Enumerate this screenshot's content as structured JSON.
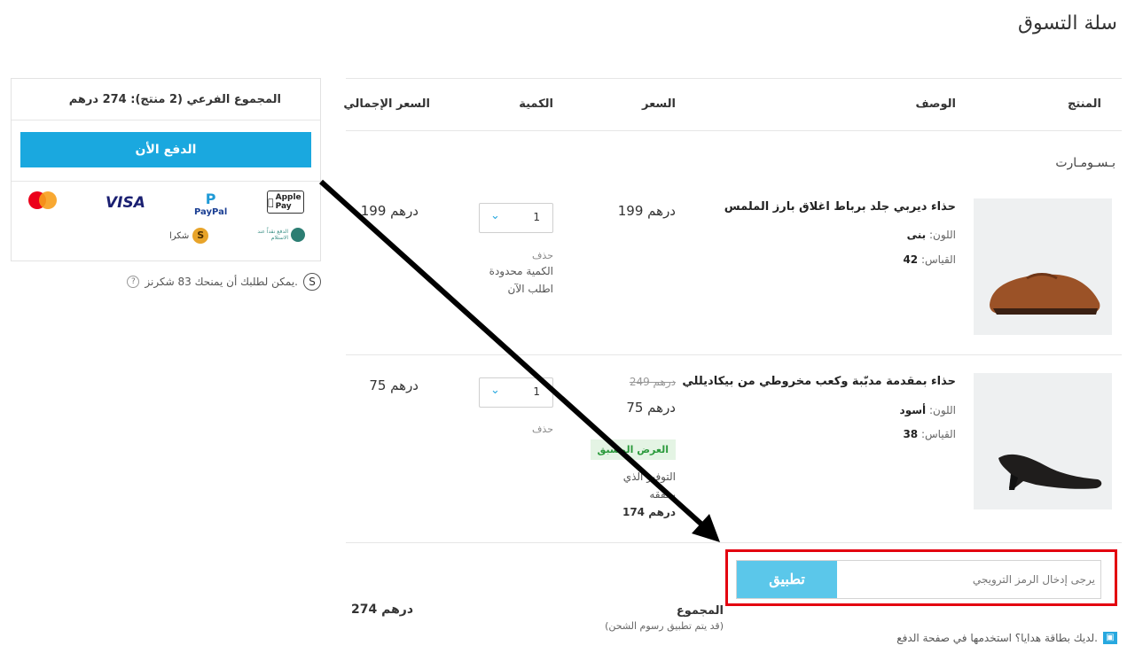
{
  "page_title": "سلة التسوق",
  "table_headers": {
    "product": "المنتج",
    "description": "الوصف",
    "price": "السعر",
    "quantity": "الكمية",
    "total_price": "السعر الإجمالي"
  },
  "store_name": "بـسـومـارت",
  "items": [
    {
      "name": "حذاء ديربي جلد برباط اغلاق بارز الملمس",
      "color_label": "اللون:",
      "color_value": "بنى",
      "size_label": "القياس:",
      "size_value": "42",
      "price": "199  درهم",
      "quantity": "1",
      "remove": "حذف",
      "stock_note": "الكمية محدودة",
      "order_now": "اطلب الآن",
      "total": "199  درهم"
    },
    {
      "name": "حذاء بمقدمة مدبّبة وكعب مخروطي من بيكاديللي",
      "color_label": "اللون:",
      "color_value": "أسود",
      "size_label": "القياس:",
      "size_value": "38",
      "old_price": "249  درهم",
      "price": "75  درهم",
      "quantity": "1",
      "remove": "حذف",
      "badge": "العرض المسبق",
      "saving_label_1": "التوفير الذي",
      "saving_label_2": "يحققه",
      "saving_value": "174  درهم",
      "total": "75  درهم"
    }
  ],
  "promo": {
    "placeholder": "يرجى إدخال الرمز الترويجي",
    "apply_label": "تطبيق"
  },
  "total": {
    "label": "المجموع",
    "note": "(قد يتم تطبيق رسوم الشحن)",
    "value": "274  درهم"
  },
  "gift_card_note": "لديك بطاقة هدايا؟ استخدمها في صفحة الدفع.",
  "sidebar": {
    "subtotal": "المجموع الفرعي (2 منتج):  274  درهم",
    "pay_now": "الدفع الأن",
    "payment_methods": [
      "Apple Pay",
      "PayPal",
      "VISA",
      "mastercard"
    ],
    "secondary_methods": [
      "الدفع نقداً عند الاستلام",
      "شكرا"
    ],
    "points_note": "يمكن لطلبك أن يمنحك 83 شكرنز."
  },
  "colors": {
    "accent": "#1aa8df",
    "apply_button": "#5bc7ea",
    "highlight_box": "#e3000f",
    "badge_bg": "#e4f4e4",
    "badge_text": "#2b9a3c"
  }
}
